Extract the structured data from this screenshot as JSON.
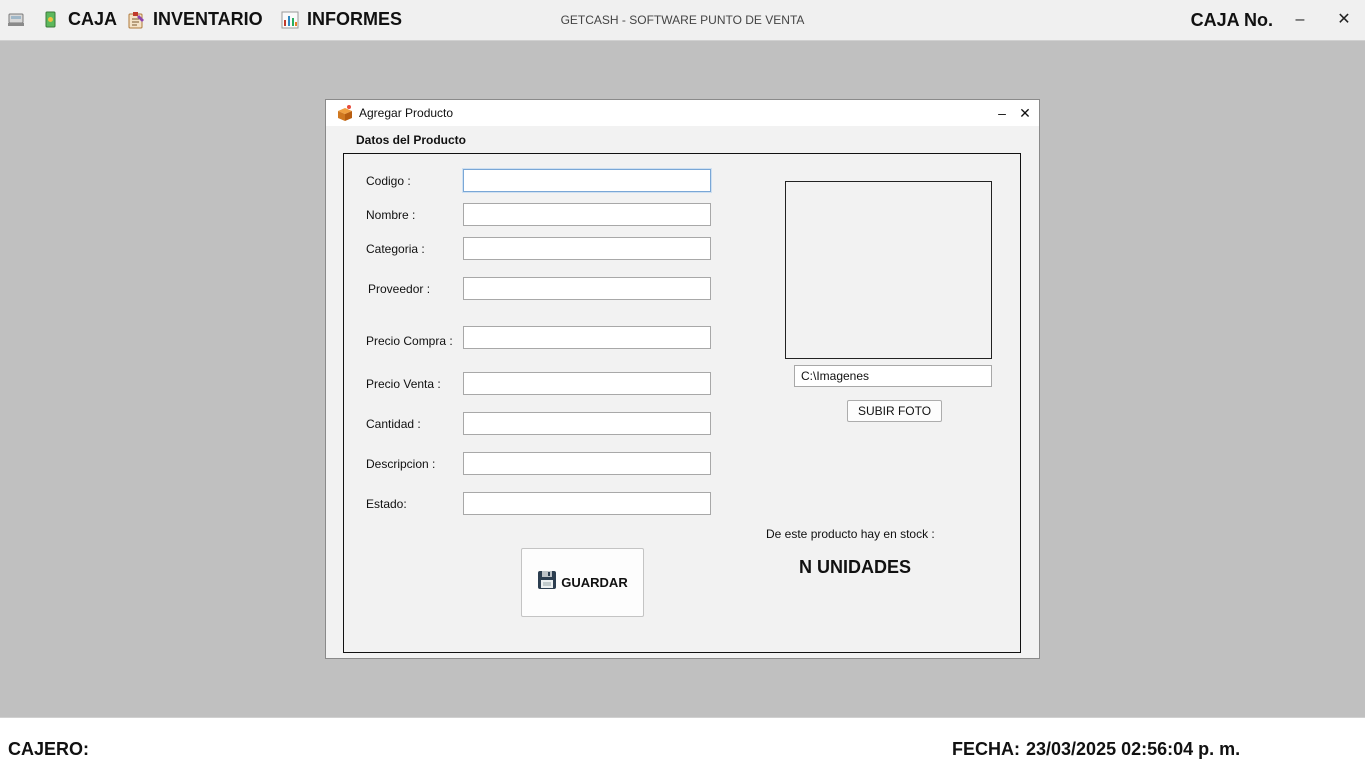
{
  "topbar": {
    "app_title": "GETCASH - SOFTWARE PUNTO DE VENTA",
    "menu": [
      {
        "label": "CAJA",
        "icon": "cash-icon"
      },
      {
        "label": "INVENTARIO",
        "icon": "clipboard-icon"
      },
      {
        "label": "INFORMES",
        "icon": "bar-chart-icon"
      }
    ],
    "caja_label": "CAJA No.",
    "minimize": "–",
    "close": "✕"
  },
  "dialog": {
    "title": "Agregar Producto",
    "minimize": "–",
    "close": "✕",
    "section_title": "Datos del Producto",
    "fields": {
      "codigo": {
        "label": "Codigo :",
        "value": ""
      },
      "nombre": {
        "label": "Nombre :",
        "value": ""
      },
      "categoria": {
        "label": "Categoria :",
        "value": ""
      },
      "proveedor": {
        "label": "Proveedor :",
        "value": ""
      },
      "precio_compra": {
        "label": "Precio Compra :",
        "value": ""
      },
      "precio_venta": {
        "label": "Precio Venta :",
        "value": ""
      },
      "cantidad": {
        "label": "Cantidad :",
        "value": ""
      },
      "descripcion": {
        "label": "Descripcion :",
        "value": ""
      },
      "estado": {
        "label": "Estado:",
        "value": ""
      }
    },
    "image_path": "C:\\Imagenes",
    "upload_button": "SUBIR FOTO",
    "stock_label": "De este producto hay en stock :",
    "stock_value": "N UNIDADES",
    "save_button": "GUARDAR"
  },
  "bottombar": {
    "cajero_label": "CAJERO:",
    "fecha_label": "FECHA:",
    "fecha_value": "23/03/2025 02:56:04 p. m."
  }
}
